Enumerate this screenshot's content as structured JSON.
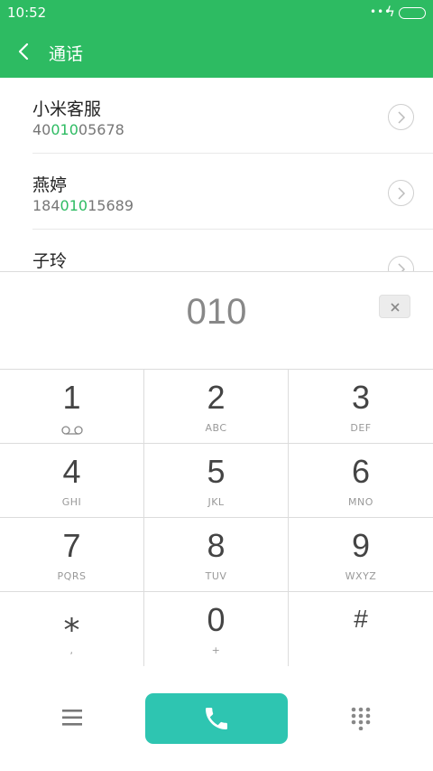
{
  "status_bar": {
    "time": "10:52",
    "signal": "•••",
    "charging": "ϟ"
  },
  "header": {
    "title": "通话",
    "back_icon": "chevron-left-icon"
  },
  "results": [
    {
      "name": "小米客服",
      "number_prefix": "40",
      "number_match": "010",
      "number_suffix": "05678"
    },
    {
      "name": "燕婷",
      "number_prefix": "184",
      "number_match": "010",
      "number_suffix": "15689"
    },
    {
      "name": "子玲",
      "number_prefix": "",
      "number_match": "",
      "number_suffix": ""
    }
  ],
  "dial_display": {
    "digits": "010"
  },
  "keypad": [
    {
      "num": "1",
      "sub": ""
    },
    {
      "num": "2",
      "sub": "ABC"
    },
    {
      "num": "3",
      "sub": "DEF"
    },
    {
      "num": "4",
      "sub": "GHI"
    },
    {
      "num": "5",
      "sub": "JKL"
    },
    {
      "num": "6",
      "sub": "MNO"
    },
    {
      "num": "7",
      "sub": "PQRS"
    },
    {
      "num": "8",
      "sub": "TUV"
    },
    {
      "num": "9",
      "sub": "WXYZ"
    },
    {
      "num": "⁎",
      "sub": ","
    },
    {
      "num": "0",
      "sub": "+"
    },
    {
      "num": "#",
      "sub": ""
    }
  ],
  "colors": {
    "brand_green": "#2dbb62",
    "call_teal": "#2ec5b1",
    "match_green": "#2dbb62"
  },
  "icons": {
    "menu": "menu-icon",
    "call": "phone-icon",
    "dialpad": "dialpad-icon",
    "backspace": "backspace-icon",
    "voicemail": "voicemail-icon"
  }
}
